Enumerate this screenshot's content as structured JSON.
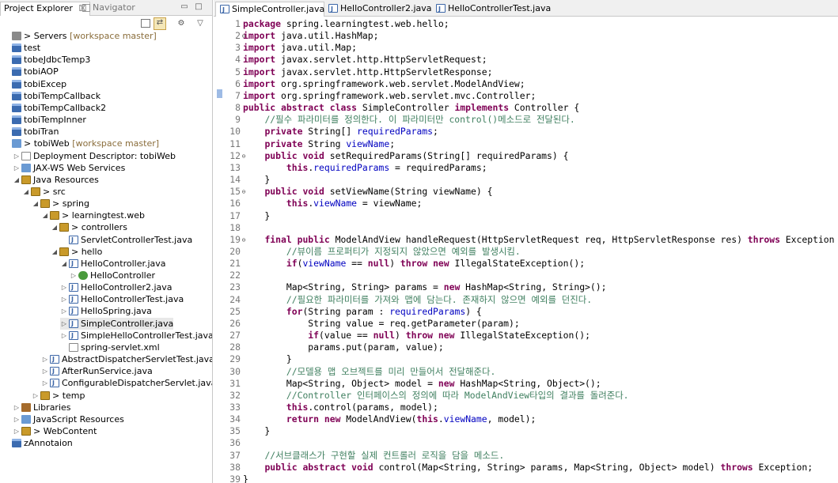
{
  "left_panel": {
    "tab_active": "Project Explorer",
    "tab_close": "☒",
    "tab_inactive": "Navigator",
    "tree": [
      {
        "label": "> Servers",
        "deco": "[workspace master]",
        "icon": "server",
        "twist": ""
      },
      {
        "label": "test",
        "icon": "project",
        "twist": ""
      },
      {
        "label": "tobeJdbcTemp3",
        "icon": "project",
        "twist": ""
      },
      {
        "label": "tobiAOP",
        "icon": "project",
        "twist": ""
      },
      {
        "label": "tobiExcep",
        "icon": "project",
        "twist": ""
      },
      {
        "label": "tobiTempCallback",
        "icon": "project",
        "twist": ""
      },
      {
        "label": "tobiTempCallback2",
        "icon": "project",
        "twist": ""
      },
      {
        "label": "tobiTempInner",
        "icon": "project",
        "twist": ""
      },
      {
        "label": "tobiTran",
        "icon": "project",
        "twist": ""
      },
      {
        "label": "> tobiWeb",
        "deco": "[workspace master]",
        "icon": "web",
        "twist": ""
      },
      {
        "label": "Deployment Descriptor: tobiWeb",
        "icon": "xml",
        "twist": "▷"
      },
      {
        "label": "JAX-WS Web Services",
        "icon": "web",
        "twist": "▷"
      },
      {
        "label": "Java Resources",
        "icon": "pkg",
        "twist": "◢"
      },
      {
        "label": "> src",
        "icon": "pkg",
        "twist": "◢"
      },
      {
        "label": "> spring",
        "icon": "pkg",
        "twist": "◢"
      },
      {
        "label": "> learningtest.web",
        "icon": "pkg",
        "twist": "◢"
      },
      {
        "label": "> controllers",
        "icon": "pkg",
        "twist": "◢"
      },
      {
        "label": "ServletControllerTest.java",
        "icon": "java",
        "twist": ""
      },
      {
        "label": "> hello",
        "icon": "pkg",
        "twist": "◢"
      },
      {
        "label": "HelloController.java",
        "icon": "java",
        "twist": "◢"
      },
      {
        "label": "HelloController",
        "icon": "class",
        "twist": "▷"
      },
      {
        "label": "HelloController2.java",
        "icon": "java",
        "twist": "▷"
      },
      {
        "label": "HelloControllerTest.java",
        "icon": "java",
        "twist": "▷"
      },
      {
        "label": "HelloSpring.java",
        "icon": "java",
        "twist": "▷"
      },
      {
        "label": "SimpleController.java",
        "icon": "java",
        "twist": "▷"
      },
      {
        "label": "SimpleHelloControllerTest.java",
        "icon": "java",
        "twist": "▷"
      },
      {
        "label": "spring-servlet.xml",
        "icon": "xml",
        "twist": ""
      },
      {
        "label": "AbstractDispatcherServletTest.java",
        "icon": "java",
        "twist": "▷"
      },
      {
        "label": "AfterRunService.java",
        "icon": "java",
        "twist": "▷"
      },
      {
        "label": "ConfigurableDispatcherServlet.java",
        "icon": "java",
        "twist": "▷"
      },
      {
        "label": "> temp",
        "icon": "pkg",
        "twist": "▷"
      },
      {
        "label": "Libraries",
        "icon": "lib",
        "twist": "▷"
      },
      {
        "label": "JavaScript Resources",
        "icon": "web",
        "twist": "▷"
      },
      {
        "label": "> WebContent",
        "icon": "pkg",
        "twist": "▷"
      },
      {
        "label": "zAnnotaion",
        "icon": "project",
        "twist": ""
      }
    ]
  },
  "editor": {
    "tabs": [
      {
        "label": "SimpleController.java",
        "close": "☒"
      },
      {
        "label": "HelloController2.java"
      },
      {
        "label": "HelloControllerTest.java"
      }
    ],
    "lines": [
      {
        "n": "1",
        "html": "<span class=\"kw\">package</span> spring.learningtest.web.hello;"
      },
      {
        "n": "2",
        "fold": "⊖",
        "html": "<span class=\"kw\">import</span> java.util.HashMap;"
      },
      {
        "n": "3",
        "html": "<span class=\"kw\">import</span> java.util.Map;"
      },
      {
        "n": "4",
        "html": "<span class=\"kw\">import</span> javax.servlet.http.HttpServletRequest;"
      },
      {
        "n": "5",
        "html": "<span class=\"kw\">import</span> javax.servlet.http.HttpServletResponse;"
      },
      {
        "n": "6",
        "html": "<span class=\"kw\">import</span> org.springframework.web.servlet.ModelAndView;"
      },
      {
        "n": "7",
        "html": "<span class=\"kw\">import</span> org.springframework.web.servlet.mvc.Controller;"
      },
      {
        "n": "8",
        "html": "<span class=\"kw\">public abstract class</span> SimpleController <span class=\"kw\">implements</span> Controller {"
      },
      {
        "n": "9",
        "html": "    <span class=\"cm\">//필수 파라미터를 정의한다. 이 파라미터만 control()메소드로 전달된다.</span>"
      },
      {
        "n": "10",
        "html": "    <span class=\"kw\">private</span> String[] <span class=\"fld\">requiredParams</span>;"
      },
      {
        "n": "11",
        "html": "    <span class=\"kw\">private</span> String <span class=\"fld\">viewName</span>;"
      },
      {
        "n": "12",
        "fold": "⊖",
        "html": "    <span class=\"kw\">public void</span> setRequiredParams(String[] requiredParams) {"
      },
      {
        "n": "13",
        "html": "        <span class=\"kw\">this</span>.<span class=\"fld\">requiredParams</span> = requiredParams;"
      },
      {
        "n": "14",
        "html": "    }"
      },
      {
        "n": "15",
        "fold": "⊖",
        "html": "    <span class=\"kw\">public void</span> setViewName(String viewName) {"
      },
      {
        "n": "16",
        "html": "        <span class=\"kw\">this</span>.<span class=\"fld\">viewName</span> = viewName;"
      },
      {
        "n": "17",
        "html": "    }"
      },
      {
        "n": "18",
        "html": ""
      },
      {
        "n": "19",
        "fold": "⊖",
        "html": "    <span class=\"kw\">final public</span> ModelAndView handleRequest(HttpServletRequest req, HttpServletResponse res) <span class=\"kw\">throws</span> Exception {"
      },
      {
        "n": "20",
        "html": "        <span class=\"cm\">//뷰이름 프로퍼티가 지정되지 않았으면 예외를 발생시킴.</span>"
      },
      {
        "n": "21",
        "html": "        <span class=\"kw\">if</span>(<span class=\"fld\">viewName</span> == <span class=\"kw\">null</span>) <span class=\"kw\">throw new</span> IllegalStateException();"
      },
      {
        "n": "22",
        "html": ""
      },
      {
        "n": "23",
        "html": "        Map&lt;String, String&gt; params = <span class=\"kw\">new</span> HashMap&lt;String, String&gt;();"
      },
      {
        "n": "24",
        "html": "        <span class=\"cm\">//필요한 파라미터를 가져와 맵에 담는다. 존재하지 않으면 예외를 던진다.</span>"
      },
      {
        "n": "25",
        "html": "        <span class=\"kw\">for</span>(String param : <span class=\"fld\">requiredParams</span>) {"
      },
      {
        "n": "26",
        "html": "            String value = req.getParameter(param);"
      },
      {
        "n": "27",
        "html": "            <span class=\"kw\">if</span>(value == <span class=\"kw\">null</span>) <span class=\"kw\">throw new</span> IllegalStateException();"
      },
      {
        "n": "28",
        "html": "            params.put(param, value);"
      },
      {
        "n": "29",
        "html": "        }"
      },
      {
        "n": "30",
        "html": "        <span class=\"cm\">//모델용 맵 오브젝트를 미리 만들어서 전달해준다.</span>"
      },
      {
        "n": "31",
        "html": "        Map&lt;String, Object&gt; model = <span class=\"kw\">new</span> HashMap&lt;String, Object&gt;();"
      },
      {
        "n": "32",
        "html": "        <span class=\"cm\">//Controller 인터페이스의 정의에 따라 ModelAndView타입의 결과를 돌려준다.</span>"
      },
      {
        "n": "33",
        "html": "        <span class=\"kw\">this</span>.control(params, model);"
      },
      {
        "n": "34",
        "html": "        <span class=\"kw\">return new</span> ModelAndView(<span class=\"kw\">this</span>.<span class=\"fld\">viewName</span>, model);"
      },
      {
        "n": "35",
        "html": "    }"
      },
      {
        "n": "36",
        "html": ""
      },
      {
        "n": "37",
        "html": "    <span class=\"cm\">//서브클래스가 구현할 실제 컨트롤러 로직을 담을 메소드.</span>"
      },
      {
        "n": "38",
        "html": "    <span class=\"kw\">public abstract void</span> control(Map&lt;String, String&gt; params, Map&lt;String, Object&gt; model) <span class=\"kw\">throws</span> Exception;"
      },
      {
        "n": "39",
        "html": "}"
      }
    ]
  }
}
